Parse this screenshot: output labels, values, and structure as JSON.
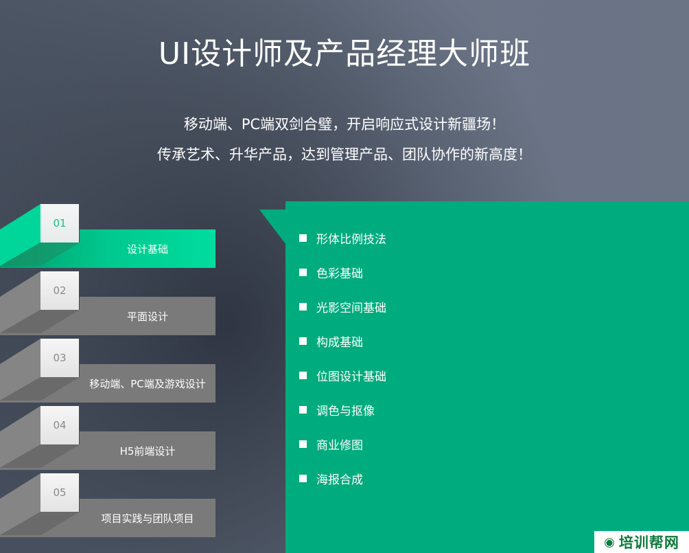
{
  "header": {
    "title": "UI设计师及产品经理大师班",
    "subtitle_line1": "移动端、PC端双剑合璧，开启响应式设计新疆场！",
    "subtitle_line2": "传承艺术、升华产品，达到管理产品、团队协作的新高度！"
  },
  "menu": {
    "active_index": 0,
    "items": [
      {
        "number": "01",
        "label": "设计基础"
      },
      {
        "number": "02",
        "label": "平面设计"
      },
      {
        "number": "03",
        "label": "移动端、PC端及游戏设计"
      },
      {
        "number": "04",
        "label": "H5前端设计"
      },
      {
        "number": "05",
        "label": "项目实践与团队项目"
      }
    ]
  },
  "panel": {
    "items": [
      "形体比例技法",
      "色彩基础",
      "光影空间基础",
      "构成基础",
      "位图设计基础",
      "调色与抠像",
      "商业修图",
      "海报合成"
    ]
  },
  "watermark": {
    "text": "培训帮网"
  },
  "colors": {
    "accent_green": "#00ab7d",
    "active_tab_green": "#00d69a",
    "inactive_tab_gray": "#7a7a7a"
  }
}
